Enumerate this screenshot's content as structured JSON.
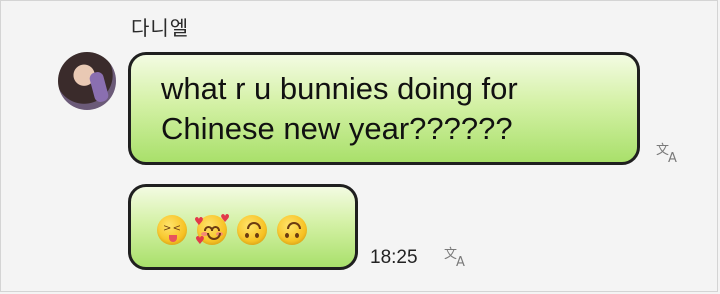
{
  "chat": {
    "sender_name": "다니엘",
    "messages": [
      {
        "text": "what r u bunnies doing for\nChinese new year??????"
      },
      {
        "emojis": [
          "squinting-face-with-tongue",
          "smiling-face-with-hearts",
          "upside-down-face",
          "upside-down-face"
        ],
        "time": "18:25"
      }
    ],
    "translate_icon": "translate-icon"
  },
  "colors": {
    "bubble_top": "#f3fbe2",
    "bubble_bottom": "#a9e06b",
    "bubble_border": "#1f1f1f",
    "background": "#f4f4f4"
  }
}
